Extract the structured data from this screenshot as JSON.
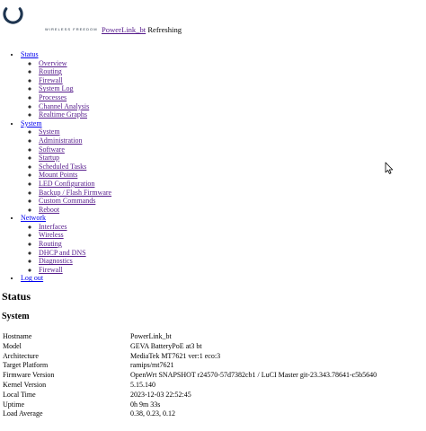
{
  "header": {
    "brand_text": "WIRELESS FREEDOM",
    "hostname_link": "PowerLink_bt",
    "status": "Refreshing"
  },
  "menu": [
    {
      "label": "Status",
      "items": [
        "Overview",
        "Routing",
        "Firewall",
        "System Log",
        "Processes",
        "Channel Analysis",
        "Realtime Graphs"
      ]
    },
    {
      "label": "System",
      "items": [
        "System",
        "Administration",
        "Software",
        "Startup",
        "Scheduled Tasks",
        "Mount Points",
        "LED Configuration",
        "Backup / Flash Firmware",
        "Custom Commands",
        "Reboot"
      ]
    },
    {
      "label": "Network",
      "items": [
        "Interfaces",
        "Wireless",
        "Routing",
        "DHCP and DNS",
        "Diagnostics",
        "Firewall"
      ]
    },
    {
      "label": "Log out",
      "items": []
    }
  ],
  "page": {
    "title": "Status",
    "section": "System"
  },
  "system_info": [
    {
      "key": "Hostname",
      "value": "PowerLink_bt"
    },
    {
      "key": "Model",
      "value": "GEVA BatteryPoE at3 bt"
    },
    {
      "key": "Architecture",
      "value": "MediaTek MT7621 ver:1 eco:3"
    },
    {
      "key": "Target Platform",
      "value": "ramips/mt7621"
    },
    {
      "key": "Firmware Version",
      "value": "OpenWrt SNAPSHOT r24570-57d7382cb1 / LuCI Master git-23.343.78641-c5b5640"
    },
    {
      "key": "Kernel Version",
      "value": "5.15.140"
    },
    {
      "key": "Local Time",
      "value": "2023-12-03 22:52:45"
    },
    {
      "key": "Uptime",
      "value": "0h 9m 33s"
    },
    {
      "key": "Load Average",
      "value": "0.38, 0.23, 0.12"
    }
  ],
  "colors": {
    "link": "#0000ee",
    "visited_link": "#551a8b",
    "logo": "#1e3550"
  }
}
